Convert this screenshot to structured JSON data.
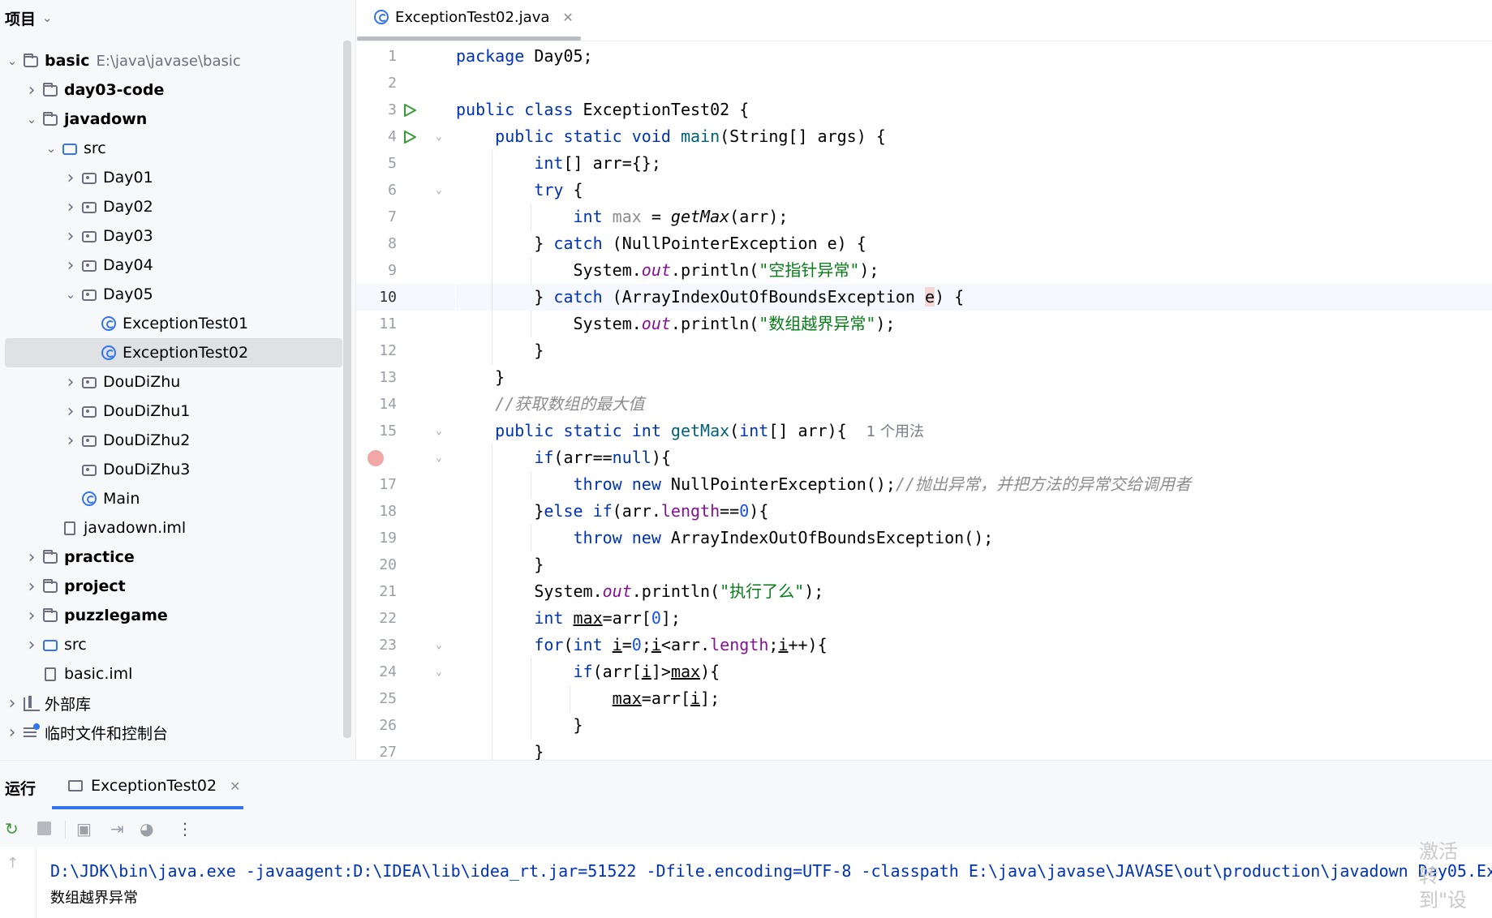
{
  "project": {
    "header": "项目",
    "tree": [
      {
        "label": "basic",
        "extra": "E:\\java\\javase\\basic",
        "level": 0,
        "arrow": "expanded",
        "icon": "module-folder-icon",
        "bold": true
      },
      {
        "label": "day03-code",
        "level": 1,
        "arrow": "collapsed",
        "icon": "module-folder-icon",
        "bold": true
      },
      {
        "label": "javadown",
        "level": 1,
        "arrow": "expanded",
        "icon": "module-folder-icon",
        "bold": true
      },
      {
        "label": "src",
        "level": 2,
        "arrow": "expanded",
        "icon": "source-folder-icon"
      },
      {
        "label": "Day01",
        "level": 3,
        "arrow": "collapsed",
        "icon": "package-icon"
      },
      {
        "label": "Day02",
        "level": 3,
        "arrow": "collapsed",
        "icon": "package-icon"
      },
      {
        "label": "Day03",
        "level": 3,
        "arrow": "collapsed",
        "icon": "package-icon"
      },
      {
        "label": "Day04",
        "level": 3,
        "arrow": "collapsed",
        "icon": "package-icon"
      },
      {
        "label": "Day05",
        "level": 3,
        "arrow": "expanded",
        "icon": "package-icon"
      },
      {
        "label": "ExceptionTest01",
        "level": 4,
        "arrow": "none",
        "icon": "java-class-icon"
      },
      {
        "label": "ExceptionTest02",
        "level": 4,
        "arrow": "none",
        "icon": "java-class-icon",
        "selected": true
      },
      {
        "label": "DouDiZhu",
        "level": 3,
        "arrow": "collapsed",
        "icon": "package-icon"
      },
      {
        "label": "DouDiZhu1",
        "level": 3,
        "arrow": "collapsed",
        "icon": "package-icon"
      },
      {
        "label": "DouDiZhu2",
        "level": 3,
        "arrow": "collapsed",
        "icon": "package-icon"
      },
      {
        "label": "DouDiZhu3",
        "level": 3,
        "arrow": "none",
        "icon": "package-icon"
      },
      {
        "label": "Main",
        "level": 3,
        "arrow": "none",
        "icon": "java-class-icon"
      },
      {
        "label": "javadown.iml",
        "level": 2,
        "arrow": "none",
        "icon": "iml-file-icon"
      },
      {
        "label": "practice",
        "level": 1,
        "arrow": "collapsed",
        "icon": "module-folder-icon",
        "bold": true
      },
      {
        "label": "project",
        "level": 1,
        "arrow": "collapsed",
        "icon": "module-folder-icon",
        "bold": true
      },
      {
        "label": "puzzlegame",
        "level": 1,
        "arrow": "collapsed",
        "icon": "module-folder-icon",
        "bold": true
      },
      {
        "label": "src",
        "level": 1,
        "arrow": "collapsed",
        "icon": "source-folder-icon"
      },
      {
        "label": "basic.iml",
        "level": 1,
        "arrow": "none",
        "icon": "iml-file-icon"
      },
      {
        "label": "外部库",
        "level": 0,
        "arrow": "collapsed",
        "icon": "library-icon"
      },
      {
        "label": "临时文件和控制台",
        "level": 0,
        "arrow": "collapsed",
        "icon": "scratches-icon"
      }
    ]
  },
  "editor": {
    "tab_label": "ExceptionTest02.java",
    "current_line": 10,
    "lines": [
      {
        "n": 1,
        "indent": 0,
        "t": [
          [
            "kw",
            "package"
          ],
          [
            "",
            " Day05;"
          ]
        ]
      },
      {
        "n": 2,
        "indent": 0,
        "t": []
      },
      {
        "n": 3,
        "indent": 0,
        "run": true,
        "t": [
          [
            "kw",
            "public class"
          ],
          [
            "",
            " ExceptionTest02 {"
          ]
        ]
      },
      {
        "n": 4,
        "indent": 1,
        "run": true,
        "fold": true,
        "t": [
          [
            "kw",
            "public static void"
          ],
          [
            "",
            " "
          ],
          [
            "fn",
            "main"
          ],
          [
            "",
            "(String[] args) {"
          ]
        ]
      },
      {
        "n": 5,
        "indent": 2,
        "t": [
          [
            "kw",
            "int"
          ],
          [
            "",
            "[] arr={};"
          ]
        ]
      },
      {
        "n": 6,
        "indent": 2,
        "fold": true,
        "t": [
          [
            "kw",
            "try"
          ],
          [
            "",
            " {"
          ]
        ]
      },
      {
        "n": 7,
        "indent": 3,
        "t": [
          [
            "kw",
            "int"
          ],
          [
            "",
            " "
          ],
          [
            "gray",
            "max"
          ],
          [
            "",
            " = "
          ],
          [
            "it",
            "getMax"
          ],
          [
            "",
            "(arr);"
          ]
        ]
      },
      {
        "n": 8,
        "indent": 2,
        "t": [
          [
            "",
            "} "
          ],
          [
            "kw",
            "catch"
          ],
          [
            "",
            " (NullPointerException e) {"
          ]
        ]
      },
      {
        "n": 9,
        "indent": 3,
        "t": [
          [
            "",
            "System."
          ],
          [
            "fld",
            "out"
          ],
          [
            "",
            ".println("
          ],
          [
            "str",
            "\"空指针异常\""
          ],
          [
            "",
            ");"
          ]
        ]
      },
      {
        "n": 10,
        "indent": 2,
        "t": [
          [
            "",
            "} "
          ],
          [
            "kw",
            "catch"
          ],
          [
            "",
            " (ArrayIndexOutOfBoundsException "
          ],
          [
            "hl",
            "e"
          ],
          [
            "",
            ") {"
          ]
        ]
      },
      {
        "n": 11,
        "indent": 3,
        "t": [
          [
            "",
            "System."
          ],
          [
            "fld",
            "out"
          ],
          [
            "",
            ".println("
          ],
          [
            "str",
            "\"数组越界异常\""
          ],
          [
            "",
            ");"
          ]
        ]
      },
      {
        "n": 12,
        "indent": 2,
        "t": [
          [
            "",
            "}"
          ]
        ]
      },
      {
        "n": 13,
        "indent": 1,
        "t": [
          [
            "",
            "}"
          ]
        ]
      },
      {
        "n": 14,
        "indent": 1,
        "t": [
          [
            "cmt",
            "//获取数组的最大值"
          ]
        ]
      },
      {
        "n": 15,
        "indent": 1,
        "fold": true,
        "t": [
          [
            "kw",
            "public static int"
          ],
          [
            "",
            " "
          ],
          [
            "fn",
            "getMax"
          ],
          [
            "",
            "("
          ],
          [
            "kw",
            "int"
          ],
          [
            "",
            "[] arr){  "
          ],
          [
            "hint",
            "1 个用法"
          ]
        ]
      },
      {
        "n": 16,
        "indent": 2,
        "bp": true,
        "fold": true,
        "t": [
          [
            "kw",
            "if"
          ],
          [
            "",
            "(arr=="
          ],
          [
            "kw",
            "null"
          ],
          [
            "",
            "){"
          ]
        ]
      },
      {
        "n": 17,
        "indent": 3,
        "t": [
          [
            "kw",
            "throw new"
          ],
          [
            "",
            " NullPointerException();"
          ],
          [
            "cmt",
            "//抛出异常，并把方法的异常交给调用者"
          ]
        ]
      },
      {
        "n": 18,
        "indent": 2,
        "t": [
          [
            "",
            "}"
          ],
          [
            "kw",
            "else if"
          ],
          [
            "",
            "(arr."
          ],
          [
            "fld2",
            "length"
          ],
          [
            "",
            "=="
          ],
          [
            "num",
            "0"
          ],
          [
            "",
            "){"
          ]
        ]
      },
      {
        "n": 19,
        "indent": 3,
        "t": [
          [
            "kw",
            "throw new"
          ],
          [
            "",
            " ArrayIndexOutOfBoundsException();"
          ]
        ]
      },
      {
        "n": 20,
        "indent": 2,
        "t": [
          [
            "",
            "}"
          ]
        ]
      },
      {
        "n": 21,
        "indent": 2,
        "t": [
          [
            "",
            "System."
          ],
          [
            "fld",
            "out"
          ],
          [
            "",
            ".println("
          ],
          [
            "str",
            "\"执行了么\""
          ],
          [
            "",
            ");"
          ]
        ]
      },
      {
        "n": 22,
        "indent": 2,
        "t": [
          [
            "kw",
            "int"
          ],
          [
            "",
            " "
          ],
          [
            "ul",
            "max"
          ],
          [
            "",
            "=arr["
          ],
          [
            "num",
            "0"
          ],
          [
            "",
            "];"
          ]
        ]
      },
      {
        "n": 23,
        "indent": 2,
        "fold": true,
        "t": [
          [
            "kw",
            "for"
          ],
          [
            "",
            "("
          ],
          [
            "kw",
            "int"
          ],
          [
            "",
            " "
          ],
          [
            "ul",
            "i"
          ],
          [
            "",
            "="
          ],
          [
            "num",
            "0"
          ],
          [
            "",
            ";"
          ],
          [
            "ul",
            "i"
          ],
          [
            "",
            "<arr."
          ],
          [
            "fld2",
            "length"
          ],
          [
            "",
            ";"
          ],
          [
            "ul",
            "i"
          ],
          [
            "",
            "++){"
          ]
        ]
      },
      {
        "n": 24,
        "indent": 3,
        "fold": true,
        "t": [
          [
            "kw",
            "if"
          ],
          [
            "",
            "(arr["
          ],
          [
            "ul",
            "i"
          ],
          [
            "",
            "]>"
          ],
          [
            "ul",
            "max"
          ],
          [
            "",
            "){"
          ]
        ]
      },
      {
        "n": 25,
        "indent": 4,
        "t": [
          [
            "ul",
            "max"
          ],
          [
            "",
            "=arr["
          ],
          [
            "ul",
            "i"
          ],
          [
            "",
            "];"
          ]
        ]
      },
      {
        "n": 26,
        "indent": 3,
        "t": [
          [
            "",
            "}"
          ]
        ]
      },
      {
        "n": 27,
        "indent": 2,
        "t": [
          [
            "",
            "}"
          ]
        ]
      }
    ]
  },
  "run": {
    "title": "运行",
    "tab_label": "ExceptionTest02",
    "console": [
      "D:\\JDK\\bin\\java.exe -javaagent:D:\\IDEA\\lib\\idea_rt.jar=51522 -Dfile.encoding=UTF-8 -classpath E:\\java\\javase\\JAVASE\\out\\production\\javadown Day05.Ex",
      "数组越界异常"
    ],
    "toolbar": [
      "rerun-icon",
      "stop-icon",
      "camera-icon",
      "login-icon",
      "gauge-icon",
      "more-icon"
    ]
  },
  "watermark": [
    "激活",
    "转到\"设"
  ]
}
